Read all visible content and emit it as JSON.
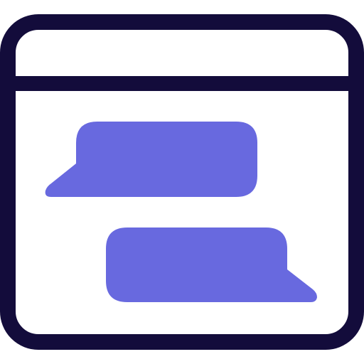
{
  "icon": {
    "name": "browser-chat-window-icon",
    "colors": {
      "outline": "#130c3b",
      "bubble": "#6869df",
      "background": "#ffffff"
    },
    "parts": {
      "window_frame": "browser-window-frame",
      "title_bar_divider": "title-bar-divider",
      "incoming_bubble": "chat-bubble-left",
      "outgoing_bubble": "chat-bubble-right"
    }
  }
}
